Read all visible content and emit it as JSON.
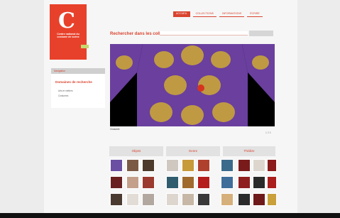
{
  "logo": {
    "glyph": "C",
    "name": "Centre national du costume de scène",
    "badge": ""
  },
  "nav": [
    {
      "label": "ACCUEIL",
      "active": true
    },
    {
      "label": "COLLECTIONS",
      "active": false
    },
    {
      "label": "INFORMATIONS",
      "active": false
    },
    {
      "label": "ÉCRIRE",
      "active": false
    }
  ],
  "search": {
    "title": "Rechercher dans les collections",
    "placeholder": "",
    "button_label": ""
  },
  "sidebar": {
    "header": "Navigation",
    "title": "Domaines de recherche",
    "items": [
      "Arts et métiers",
      "Costumes"
    ]
  },
  "hero": {
    "caption": "Chasuble"
  },
  "pager": "1 2 3",
  "categories": [
    "Objets",
    "Genre",
    "Théâtre"
  ],
  "colors": {
    "accent": "#d9442f",
    "garment_purple": "#6a3f9e",
    "garment_gold": "#c9a43a",
    "motif_red": "#d7341f"
  },
  "thumbnails": [
    [
      "#6a4fa2",
      "#7b5a45",
      "#4d3a2c",
      "#cfc8c0",
      "#c79a3a",
      "#b0402e",
      "#3a6b8b",
      "#7a1b1b",
      "#dcd6cf",
      "#8c1b1b"
    ],
    [
      "#6a2020",
      "#c4a08a",
      "#9b3a2e",
      "#2f5d6e",
      "#a06a2d",
      "#b51d1d",
      "#3f6e9b",
      "#8f1f1f",
      "#2a2a2a",
      "#aa1e1e"
    ],
    [
      "#4b3a2f",
      "#e1ddd6",
      "#b3a8a0",
      "#ddd6ce",
      "#c7b7a6",
      "#393939",
      "#d6b07a",
      "#2b2b2b",
      "#6e1a1a",
      "#c9a03a"
    ]
  ]
}
